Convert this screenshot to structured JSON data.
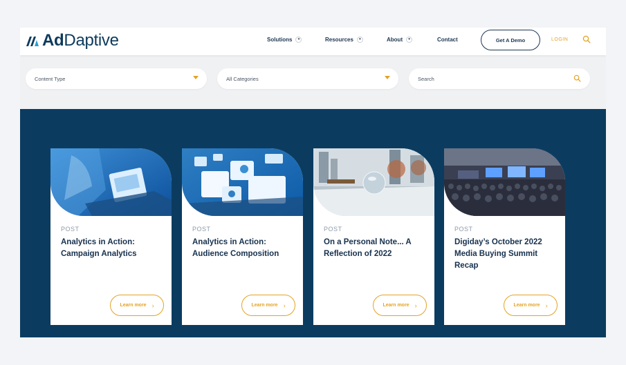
{
  "brand": {
    "name_bold": "Ad",
    "name_light": "Daptive",
    "colors": {
      "navy": "#0b3c60",
      "accent": "#e3a324"
    }
  },
  "nav": {
    "items": [
      {
        "label": "Solutions",
        "has_dropdown": true
      },
      {
        "label": "Resources",
        "has_dropdown": true
      },
      {
        "label": "About",
        "has_dropdown": true
      },
      {
        "label": "Contact",
        "has_dropdown": false
      }
    ],
    "demo_label": "Get A Demo",
    "login_label": "LOGIN",
    "search_icon": "search-icon"
  },
  "filters": {
    "content_type": "Content Type",
    "categories": "All Categories",
    "search_placeholder": "Search"
  },
  "cards": [
    {
      "type": "POST",
      "title": "Analytics in Action: Campaign Analytics",
      "cta": "Learn more",
      "image": "laptop-analytics"
    },
    {
      "type": "POST",
      "title": "Analytics in Action: Audience Composition",
      "cta": "Learn more",
      "image": "dashboard-panels"
    },
    {
      "type": "POST",
      "title": "On a Personal Note... A Reflection of 2022",
      "cta": "Learn more",
      "image": "crystal-ball-city"
    },
    {
      "type": "POST",
      "title": "Digiday’s October 2022 Media Buying Summit Recap",
      "cta": "Learn more",
      "image": "conference-hall"
    }
  ]
}
